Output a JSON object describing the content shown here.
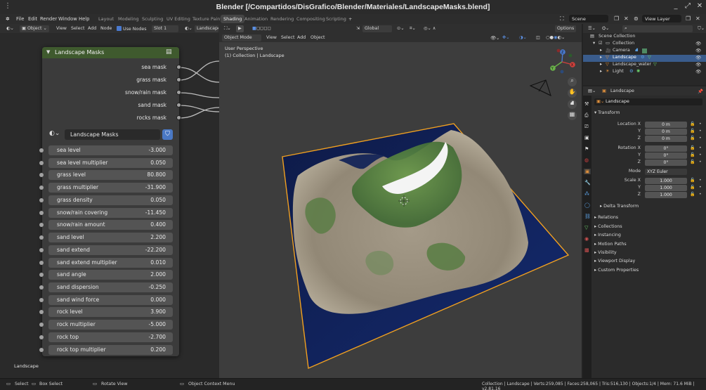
{
  "window": {
    "title": "Blender [/Compartidos/DisGrafico/Blender/Materiales/LandscapeMasks.blend]"
  },
  "menubar": {
    "menus": [
      "File",
      "Edit",
      "Render",
      "Window",
      "Help"
    ],
    "workspaces": [
      "Layout",
      "Modeling",
      "Sculpting",
      "UV Editing",
      "Texture Paint",
      "Shading",
      "Animation",
      "Rendering",
      "Compositing",
      "Scripting"
    ],
    "active_workspace": "Shading",
    "add_tab": "+",
    "scene_label": "Scene",
    "view_layer_label": "View Layer"
  },
  "node_editor": {
    "header": {
      "mode": "Object",
      "menus": [
        "View",
        "Select",
        "Add",
        "Node"
      ],
      "use_nodes_label": "Use Nodes",
      "slot": "Slot 1",
      "material": "Landscape"
    },
    "node": {
      "title": "Landscape Masks",
      "outputs": [
        "sea mask",
        "grass mask",
        "snow/rain mask",
        "sand mask",
        "rocks mask"
      ],
      "group_name": "Landscape Masks",
      "params": [
        {
          "label": "sea level",
          "value": "-3.000"
        },
        {
          "label": "sea level multiplier",
          "value": "0.050"
        },
        {
          "label": "grass level",
          "value": "80.800"
        },
        {
          "label": "grass multiplier",
          "value": "-31.900"
        },
        {
          "label": "grass density",
          "value": "0.050"
        },
        {
          "label": "snow/rain covering",
          "value": "-11.450"
        },
        {
          "label": "snow/rain amount",
          "value": "0.400"
        },
        {
          "label": "sand level",
          "value": "2.200"
        },
        {
          "label": "sand extend",
          "value": "-22.200"
        },
        {
          "label": "sand extend multiplier",
          "value": "0.010"
        },
        {
          "label": "sand angle",
          "value": "2.000"
        },
        {
          "label": "sand dispersion",
          "value": "-0.250"
        },
        {
          "label": "sand wind force",
          "value": "0.000"
        },
        {
          "label": "rock level",
          "value": "3.900"
        },
        {
          "label": "rock multiplier",
          "value": "-5.000"
        },
        {
          "label": "rock top",
          "value": "-2.700"
        },
        {
          "label": "rock top multiplier",
          "value": "0.200"
        }
      ]
    },
    "footer_label": "Landscape"
  },
  "viewport": {
    "mode": "Object Mode",
    "menus": [
      "View",
      "Select",
      "Add",
      "Object"
    ],
    "orientation": "Global",
    "options_label": "Options",
    "perspective_label": "User Perspective",
    "collection_label": "(1) Collection | Landscape",
    "gizmo_axes": [
      "X",
      "Y",
      "Z"
    ]
  },
  "outliner": {
    "root": "Scene Collection",
    "collection": "Collection",
    "items": [
      "Camera",
      "Landscape",
      "Landscape_water",
      "Light"
    ],
    "selected": "Landscape"
  },
  "properties": {
    "object_name": "Landscape",
    "data_name": "Landscape",
    "transform_label": "Transform",
    "location": {
      "label": "Location X",
      "x": "0 m",
      "y": "0 m",
      "z": "0 m"
    },
    "rotation": {
      "label": "Rotation X",
      "x": "0°",
      "y": "0°",
      "z": "0°"
    },
    "mode": {
      "label": "Mode",
      "value": "XYZ Euler"
    },
    "scale": {
      "label": "Scale X",
      "x": "1.000",
      "y": "1.000",
      "z": "1.000"
    },
    "axis_y": "Y",
    "axis_z": "Z",
    "sections": [
      "Delta Transform",
      "Relations",
      "Collections",
      "Instancing",
      "Motion Paths",
      "Visibility",
      "Viewport Display",
      "Custom Properties"
    ]
  },
  "statusbar": {
    "select": "Select",
    "box_select": "Box Select",
    "rotate_view": "Rotate View",
    "context_menu": "Object Context Menu",
    "stats": "Collection | Landscape | Verts:259,085 | Faces:258,065 | Tris:516,130 | Objects:1/4 | Mem: 71.6 MiB | v2.81.16"
  },
  "colors": {
    "node_header_green": "#3f5a2e",
    "selection_blue": "#3a5c8c",
    "water": "#0f1d4a",
    "outline_orange": "#f0a020",
    "grass": "#5f8a45",
    "sand": "#9b9180",
    "snow": "#f4f4f4"
  }
}
